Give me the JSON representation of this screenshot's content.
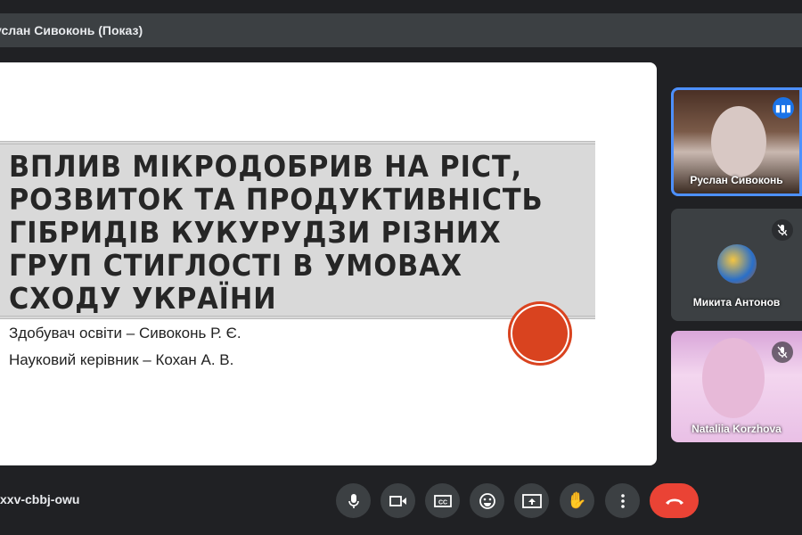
{
  "banner": {
    "presenter": "услан Сивоконь (Показ)"
  },
  "slide": {
    "title": "ВПЛИВ МІКРОДОБРИВ НА РІСТ, РОЗВИТОК ТА ПРОДУКТИВНІСТЬ ГІБРИДІВ КУКУРУДЗИ РІЗНИХ ГРУП СТИГЛОСТІ В УМОВАХ СХОДУ УКРАЇНИ",
    "author": "Здобувач освіти – Сивоконь Р. Є.",
    "supervisor": "Науковий керівник – Кохан А. В."
  },
  "participants": [
    {
      "name": "Руслан Сивоконь",
      "state": "speaking"
    },
    {
      "name": "Микита Антонов",
      "state": "muted"
    },
    {
      "name": "Nataliia Korzhova",
      "state": "muted"
    }
  ],
  "meeting_code": "xxv-cbbj-owu",
  "controls": [
    "microphone",
    "camera",
    "captions",
    "emoji",
    "present",
    "raise-hand",
    "more-options",
    "leave-call"
  ],
  "colors": {
    "end_call": "#ea4335",
    "accent": "#1a73e8",
    "slide_circle": "#d9431f"
  }
}
